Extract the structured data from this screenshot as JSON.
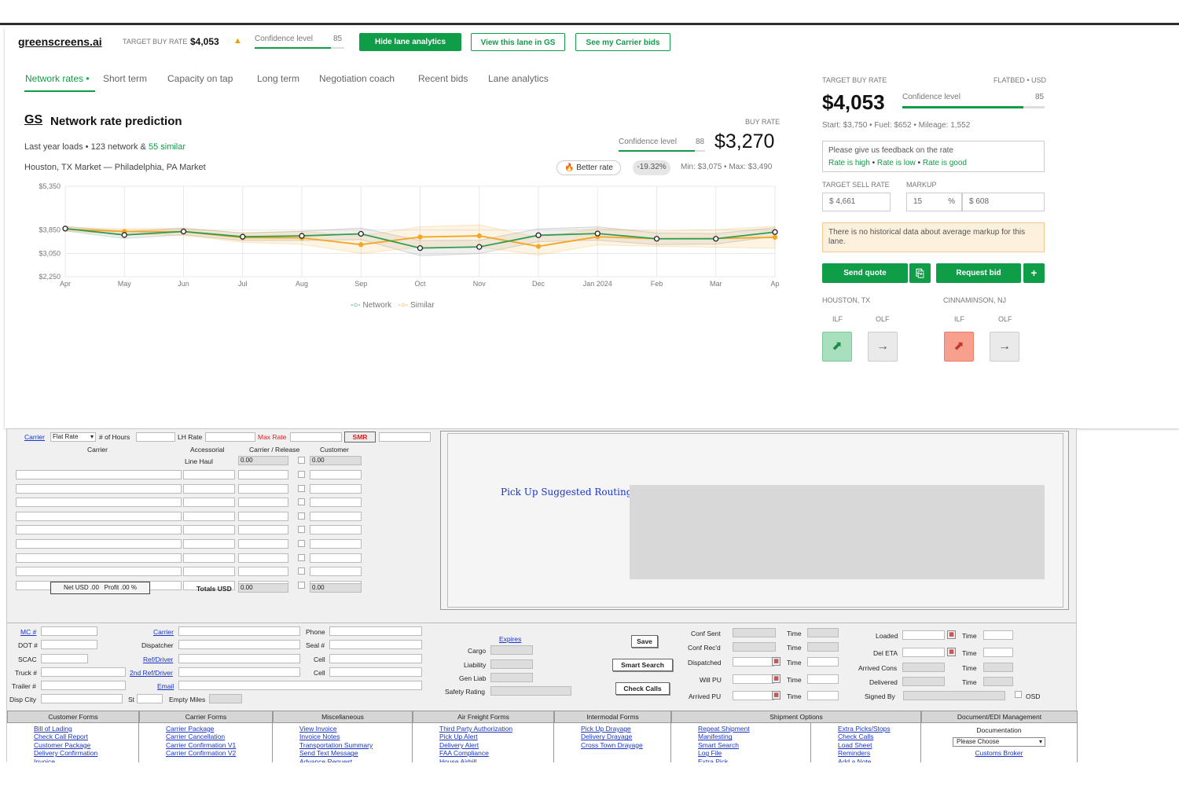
{
  "topbar": {
    "logo": "greenscreens.ai",
    "target_buy_label": "TARGET BUY RATE",
    "target_buy_value": "$4,053",
    "confidence_label": "Confidence level",
    "confidence_value": "85",
    "hide_btn": "Hide lane analytics",
    "view_btn": "View this lane in GS",
    "carrier_btn": "See my Carrier bids"
  },
  "tabs": [
    "Network rates",
    "Short term",
    "Capacity on tap",
    "Long term",
    "Negotiation coach",
    "Recent bids",
    "Lane analytics"
  ],
  "prediction": {
    "gs": "GS",
    "title": "Network rate prediction",
    "loads_prefix": "Last year loads",
    "network_count": "123 network &",
    "similar_count": "55 similar",
    "lane": "Houston, TX Market — Philadelphia, PA Market",
    "buy_rate_label": "BUY RATE",
    "confidence_label": "Confidence level",
    "confidence_value": "88",
    "buy_rate_value": "$3,270",
    "better_rate": "Better rate",
    "pct": "-19.32%",
    "min": "Min: $3,075",
    "max": "Max: $3,490"
  },
  "chart_data": {
    "type": "line",
    "x": [
      "Apr",
      "May",
      "Jun",
      "Jul",
      "Aug",
      "Sep",
      "Oct",
      "Nov",
      "Dec",
      "Jan 2024",
      "Feb",
      "Mar",
      "Ap"
    ],
    "yticks": [
      "$5,350",
      "$3,850",
      "$3,050",
      "$2,250"
    ],
    "ylim": [
      2250,
      5350
    ],
    "series": [
      {
        "name": "Network",
        "color": "#2e9e54",
        "values": [
          3900,
          3680,
          3800,
          3620,
          3650,
          3720,
          3230,
          3270,
          3670,
          3730,
          3550,
          3550,
          3780
        ]
      },
      {
        "name": "Similar",
        "color": "#f5a623",
        "values": [
          3880,
          3800,
          3790,
          3590,
          3580,
          3350,
          3610,
          3650,
          3290,
          3620,
          3550,
          3560,
          3600
        ]
      }
    ],
    "grid": true,
    "legend": "bottom"
  },
  "side": {
    "target_buy_label": "TARGET BUY RATE",
    "equipment": "FLATBED • USD",
    "target_buy_value": "$4,053",
    "confidence_label": "Confidence level",
    "confidence_value": "85",
    "start": "Start: $3,750",
    "fuel": "Fuel: $652",
    "mileage": "Mileage: 1,552",
    "feedback_title": "Please give us feedback on the rate",
    "rate_high": "Rate is high",
    "rate_low": "Rate is low",
    "rate_good": "Rate is good",
    "sell_label": "TARGET SELL RATE",
    "markup_label": "MARKUP",
    "sell_value": "$ 4,661",
    "markup_pct": "15",
    "pct_sign": "%",
    "markup_amt": "$ 608",
    "no_data": "There is no historical data about average markup for this lane.",
    "send_quote": "Send quote",
    "request_bid": "Request bid",
    "plus": "+",
    "origin": "HOUSTON, TX",
    "dest": "CINNAMINSON, NJ",
    "ilf": "ILF",
    "olf": "OLF"
  },
  "legacy": {
    "carrier_link": "Carrier",
    "flat_rate": "Flat Rate",
    "num_hours": "# of Hours",
    "lh_rate": "LH Rate",
    "max_rate": "Max Rate",
    "smr": "SMR",
    "col_carrier": "Carrier",
    "col_accessorial": "Accessorial",
    "col_release": "Carrier / Release",
    "col_customer": "Customer",
    "line_haul": "Line Haul",
    "zero": "0.00",
    "net": "Net USD .00",
    "profit": "Profit .00 %",
    "totals": "Totals USD",
    "routing": "Pick Up Suggested Routing",
    "mc": "MC #",
    "dot": "DOT #",
    "scac": "SCAC",
    "truck": "Truck #",
    "trailer": "Trailer #",
    "disp_city": "Disp City",
    "st": "St",
    "carrier2": "Carrier",
    "dispatcher": "Dispatcher",
    "ref_driver": "Ref/Driver",
    "ref_driver2": "2nd Ref/Driver",
    "email": "Email",
    "empty_miles": "Empty Miles",
    "phone": "Phone",
    "seal": "Seal #",
    "cell": "Cell",
    "expires": "Expires",
    "cargo": "Cargo",
    "liability": "Liability",
    "gen_liab": "Gen Liab",
    "safety": "Safety Rating",
    "save": "Save",
    "smart_search": "Smart Search",
    "check_calls": "Check Calls",
    "conf_sent": "Conf Sent",
    "conf_recd": "Conf Rec'd",
    "dispatched": "Dispatched",
    "will_pu": "Will PU",
    "arrived_pu": "Arrived PU",
    "time": "Time",
    "loaded": "Loaded",
    "del_eta": "Del ETA",
    "arrived_cons": "Arrived Cons",
    "delivered": "Delivered",
    "signed_by": "Signed By",
    "osd": "OSD",
    "forms": [
      {
        "title": "Customer Forms",
        "links": [
          "Bill of Lading",
          "Check Call Report",
          "Customer Package",
          "Delivery Confirmation",
          "Invoice"
        ]
      },
      {
        "title": "Carrier Forms",
        "links": [
          "Carrier Package",
          "Carrier Cancellation",
          "Carrier Confirmation V1",
          "Carrier Confirmation V2"
        ]
      },
      {
        "title": "Miscellaneous",
        "links": [
          "View Invoice",
          "Invoice Notes",
          "Transportation Summary",
          "Send Text Message",
          "Advance Request"
        ]
      },
      {
        "title": "Air Freight Forms",
        "links": [
          "Third Party Authorization",
          "Pick Up Alert",
          "Delivery Alert",
          "FAA Compliance",
          "House Airbill"
        ]
      },
      {
        "title": "Intermodal Forms",
        "links": [
          "Pick Up Drayage",
          "Delivery Drayage",
          "Cross Town Drayage"
        ]
      },
      {
        "title": "Shipment Options",
        "links": [
          "Repeat Shipment",
          "Manifesting",
          "Smart Search",
          "Log File",
          "Extra Pick"
        ]
      },
      {
        "title": "",
        "links": [
          "Extra Picks/Stops",
          "Check Calls",
          "Load Sheet",
          "Reminders",
          "Add a Note"
        ]
      },
      {
        "title": "Document/EDI Management",
        "links": []
      }
    ],
    "documentation": "Documentation",
    "please_choose": "Please Choose",
    "customs_broker": "Customs Broker"
  }
}
